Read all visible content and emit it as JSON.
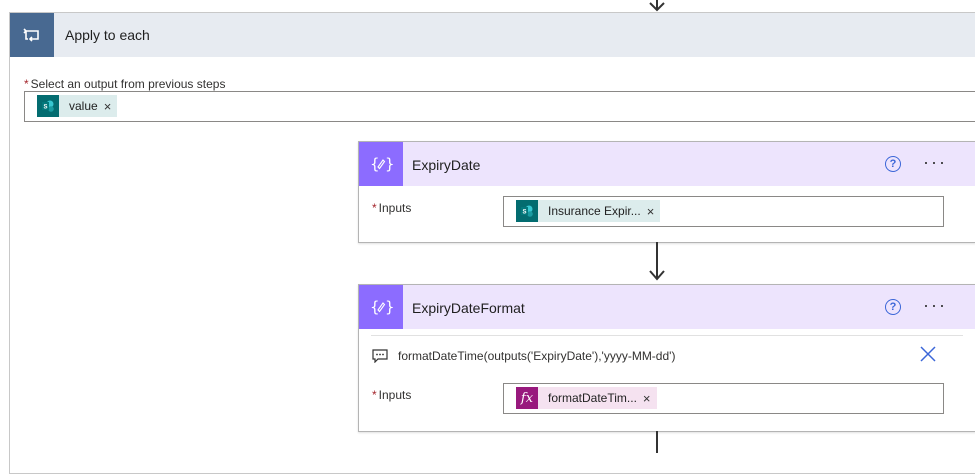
{
  "apply_to_each": {
    "title": "Apply to each",
    "select_label": "Select an output from previous steps",
    "required_marker": "*",
    "token": {
      "label": "value",
      "icon": "sharepoint-icon",
      "close": "×"
    }
  },
  "cards": [
    {
      "title": "ExpiryDate",
      "help": "?",
      "more": "···",
      "inputs_label": "Inputs",
      "required_marker": "*",
      "token": {
        "label": "Insurance Expir...",
        "icon": "sharepoint-icon",
        "close": "×"
      }
    },
    {
      "title": "ExpiryDateFormat",
      "help": "?",
      "more": "···",
      "expression": "formatDateTime(outputs('ExpiryDate'),'yyyy-MM-dd')",
      "inputs_label": "Inputs",
      "required_marker": "*",
      "token": {
        "label": "formatDateTim...",
        "icon": "fx-icon",
        "glyph": "fx",
        "close": "×"
      }
    }
  ],
  "colors": {
    "apply_header_bg": "#e7ebf1",
    "apply_icon_bg": "#486991",
    "card_header_bg": "#ede4fd",
    "card_icon_bg": "#8c6cff",
    "sharepoint_token_icon": "#036c70",
    "fx_token_icon": "#98197d",
    "sp_token_bg": "#dcecec",
    "fx_token_bg": "#f5e2f0",
    "help_blue": "#3b66d8"
  }
}
